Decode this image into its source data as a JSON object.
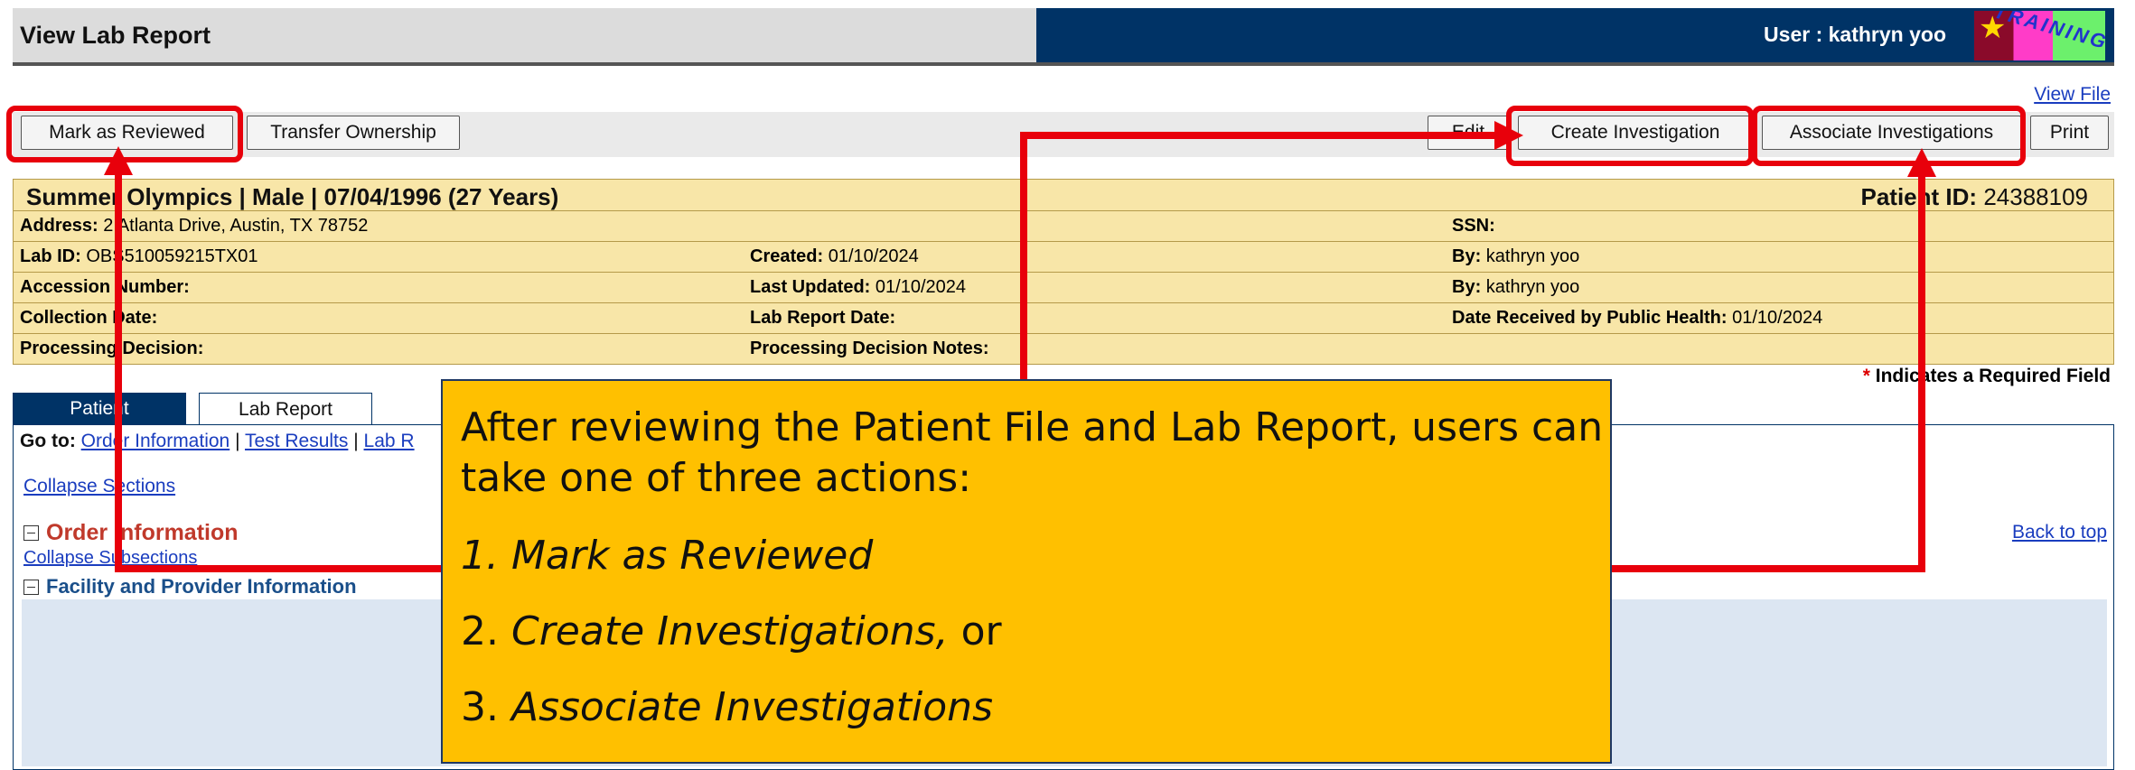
{
  "header": {
    "title": "View Lab Report",
    "user_label": "User : kathryn yoo",
    "logo_text": "TRAINING",
    "logo_star": "★"
  },
  "toolbar": {
    "view_file": "View File",
    "mark_reviewed": "Mark as Reviewed",
    "transfer_ownership": "Transfer Ownership",
    "edit": "Edit",
    "create_investigation": "Create Investigation",
    "associate_investigations": "Associate Investigations",
    "print": "Print"
  },
  "patient": {
    "summary": "Summer Olympics  |  Male  |  07/04/1996 (27 Years)",
    "id_label": "Patient ID:",
    "id_value": "24388109",
    "rows": [
      [
        {
          "label": "Address:",
          "value": "2 Atlanta Drive, Austin, TX 78752"
        },
        {
          "label": "",
          "value": ""
        },
        {
          "label": "SSN:",
          "value": ""
        }
      ],
      [
        {
          "label": "Lab ID:",
          "value": "OBS510059215TX01"
        },
        {
          "label": "Created:",
          "value": "01/10/2024"
        },
        {
          "label": "By:",
          "value": "kathryn yoo"
        }
      ],
      [
        {
          "label": "Accession Number:",
          "value": ""
        },
        {
          "label": "Last Updated:",
          "value": "01/10/2024"
        },
        {
          "label": "By:",
          "value": "kathryn yoo"
        }
      ],
      [
        {
          "label": "Collection Date:",
          "value": ""
        },
        {
          "label": "Lab Report Date:",
          "value": ""
        },
        {
          "label": "Date Received by Public Health:",
          "value": "01/10/2024"
        }
      ],
      [
        {
          "label": "Processing Decision:",
          "value": ""
        },
        {
          "label": "Processing Decision Notes:",
          "value": ""
        },
        {
          "label": "",
          "value": ""
        }
      ]
    ]
  },
  "required_note": {
    "star": "*",
    "text": "Indicates a Required Field"
  },
  "tabs": {
    "patient": "Patient",
    "lab_report": "Lab Report"
  },
  "content": {
    "goto_label": "Go to:",
    "goto_order": "Order Information",
    "goto_sep1": "|",
    "goto_tests": "Test Results",
    "goto_sep2": "|",
    "goto_lab": "Lab R",
    "collapse_sections": "Collapse Sections",
    "order_information": "Order Information",
    "back_to_top": "Back to top",
    "collapse_subsections": "Collapse Subsections",
    "facility_provider": "Facility and Provider Information"
  },
  "callout": {
    "line1": "After reviewing the Patient File and Lab Report, users can",
    "line2": "take one of three actions:",
    "item1": "1. Mark as Reviewed",
    "item2_prefix": "2. ",
    "item2_italic": "Create Investigations,",
    "item2_suffix": " or",
    "item3_prefix": "3. ",
    "item3_italic": "Associate Investigations"
  },
  "colors": {
    "highlight": "#e8000b",
    "callout_bg": "#ffc000",
    "header_bg": "#003366"
  }
}
